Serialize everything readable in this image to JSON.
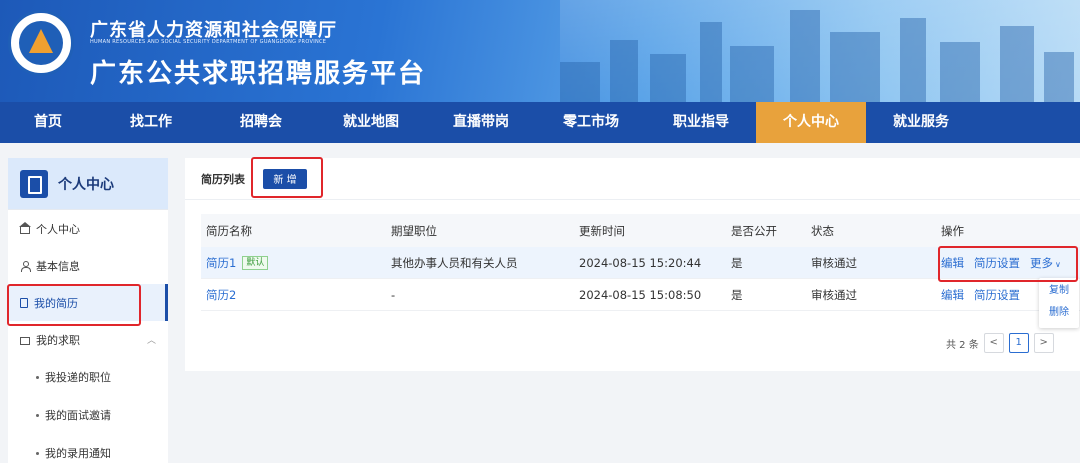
{
  "header": {
    "org_title": "广东省人力资源和社会保障厅",
    "org_subtitle": "HUMAN RESOURCES AND SOCIAL SECURITY DEPARTMENT OF GUANGDONG PROVINCE",
    "platform_title": "广东公共求职招聘服务平台"
  },
  "nav": {
    "items": [
      "首页",
      "找工作",
      "招聘会",
      "就业地图",
      "直播带岗",
      "零工市场",
      "职业指导",
      "个人中心",
      "就业服务"
    ],
    "active": "个人中心"
  },
  "sidebar": {
    "title": "个人中心",
    "items": [
      "个人中心",
      "基本信息",
      "我的简历",
      "我的求职"
    ],
    "sub_items": [
      "我投递的职位",
      "我的面试邀请",
      "我的录用通知"
    ],
    "active": "我的简历"
  },
  "main": {
    "tab_label": "简历列表",
    "add_button": "新 增",
    "columns": [
      "简历名称",
      "期望职位",
      "更新时间",
      "是否公开",
      "状态",
      "操作"
    ],
    "rows": [
      {
        "name": "简历1",
        "badge": "默认",
        "position": "其他办事人员和有关人员",
        "updated": "2024-08-15 15:20:44",
        "public": "是",
        "status": "审核通过"
      },
      {
        "name": "简历2",
        "badge": "",
        "position": "-",
        "updated": "2024-08-15 15:08:50",
        "public": "是",
        "status": "审核通过"
      }
    ],
    "actions": {
      "edit": "编辑",
      "settings": "简历设置",
      "more": "更多"
    },
    "dropdown": [
      "复制",
      "删除"
    ],
    "pagination": {
      "total": "共 2 条",
      "current": "1",
      "prev": "<",
      "next": ">"
    }
  },
  "colors": {
    "nav_bg": "#1b4ea8",
    "nav_active": "#e8a23c",
    "link": "#2a6dd1",
    "highlight": "#e0262b"
  }
}
